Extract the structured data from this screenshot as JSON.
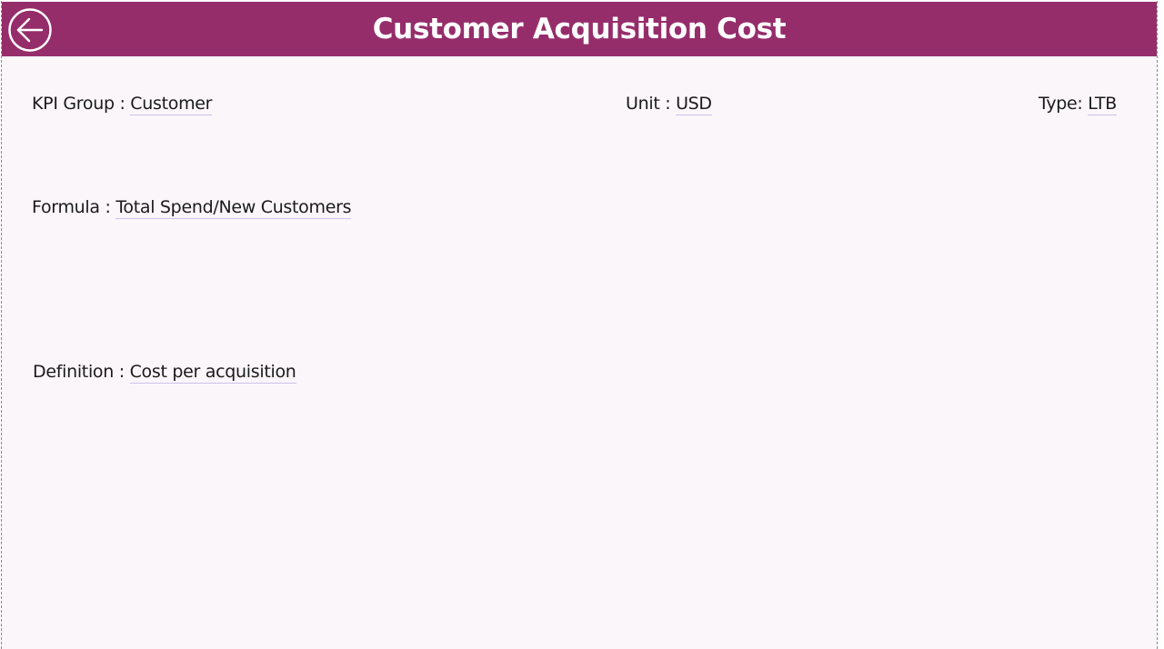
{
  "header": {
    "title": "Customer Acquisition Cost",
    "back_icon": "arrow-left-circle-icon",
    "background_color": "#962d6b"
  },
  "fields": {
    "kpi_group": {
      "label": "KPI Group : ",
      "value": "Customer"
    },
    "unit": {
      "label": "Unit : ",
      "value": "USD"
    },
    "type": {
      "label": "Type: ",
      "value": "LTB"
    },
    "formula": {
      "label": "Formula : ",
      "value": "Total Spend/New Customers"
    },
    "definition": {
      "label": "Definition : ",
      "value": "Cost per acquisition"
    }
  }
}
